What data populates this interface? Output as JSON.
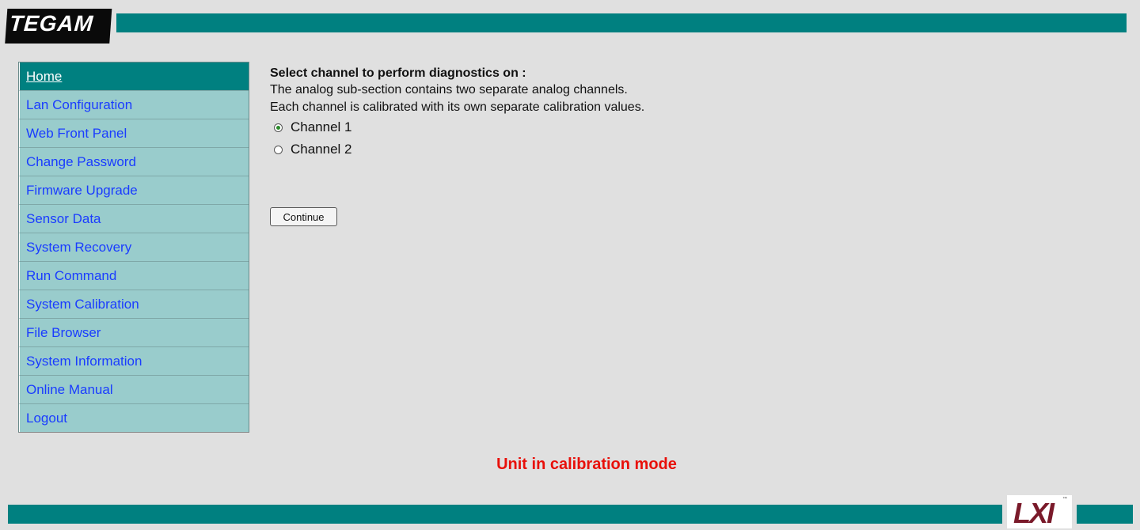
{
  "header": {
    "logo_text": "TEGAM"
  },
  "sidebar": {
    "items": [
      {
        "label": "Home",
        "active": true
      },
      {
        "label": "Lan Configuration"
      },
      {
        "label": "Web Front Panel"
      },
      {
        "label": "Change Password"
      },
      {
        "label": "Firmware Upgrade"
      },
      {
        "label": "Sensor Data"
      },
      {
        "label": "System Recovery"
      },
      {
        "label": "Run Command"
      },
      {
        "label": "System Calibration"
      },
      {
        "label": "File Browser"
      },
      {
        "label": "System Information"
      },
      {
        "label": "Online Manual"
      },
      {
        "label": "Logout"
      }
    ]
  },
  "main": {
    "heading": "Select channel to perform diagnostics on :",
    "line1": "The analog sub-section contains two separate analog channels.",
    "line2": "Each channel is calibrated with its own separate calibration values.",
    "channels": [
      {
        "label": "Channel 1",
        "checked": true
      },
      {
        "label": "Channel 2",
        "checked": false
      }
    ],
    "continue_label": "Continue"
  },
  "status": {
    "calibration_message": "Unit in calibration mode"
  },
  "footer": {
    "lxi_logo_text": "LXI"
  },
  "colors": {
    "teal": "#008080",
    "nav_bg": "#99cccc",
    "link": "#1a3cff",
    "alert": "#e8100a",
    "page_bg": "#e0e0e0"
  }
}
